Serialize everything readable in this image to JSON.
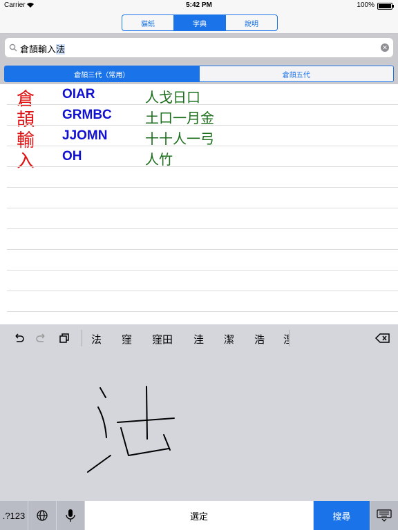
{
  "statusbar": {
    "carrier": "Carrier",
    "time": "5:42 PM",
    "battery": "100%"
  },
  "tabs": [
    {
      "label": "貓紙",
      "active": false
    },
    {
      "label": "字典",
      "active": true
    },
    {
      "label": "說明",
      "active": false
    }
  ],
  "search": {
    "prefix": "倉頡輸入",
    "highlighted": "法"
  },
  "versions": [
    {
      "label": "倉頡三代（常用）",
      "active": true
    },
    {
      "label": "倉頡五代",
      "active": false
    }
  ],
  "results": [
    {
      "char": "倉",
      "code": "OIAR",
      "components": "人戈日口"
    },
    {
      "char": "頡",
      "code": "GRMBC",
      "components": "土口一月金"
    },
    {
      "char": "輸",
      "code": "JJOMN",
      "components": "十十人一弓"
    },
    {
      "char": "入",
      "code": "OH",
      "components": "人竹"
    }
  ],
  "keyboard": {
    "candidates": [
      "法",
      "窪",
      "窪田",
      "洼",
      "潔",
      "浩",
      "涅"
    ],
    "handwriting": "法",
    "keys": {
      "numbers": ".?123",
      "space": "選定",
      "search": "搜尋"
    }
  },
  "icons": [
    "wifi-icon",
    "battery-icon",
    "search-icon",
    "clear-icon",
    "undo-icon",
    "redo-icon",
    "paste-icon",
    "backspace-icon",
    "globe-icon",
    "mic-icon",
    "hide-keyboard-icon"
  ]
}
